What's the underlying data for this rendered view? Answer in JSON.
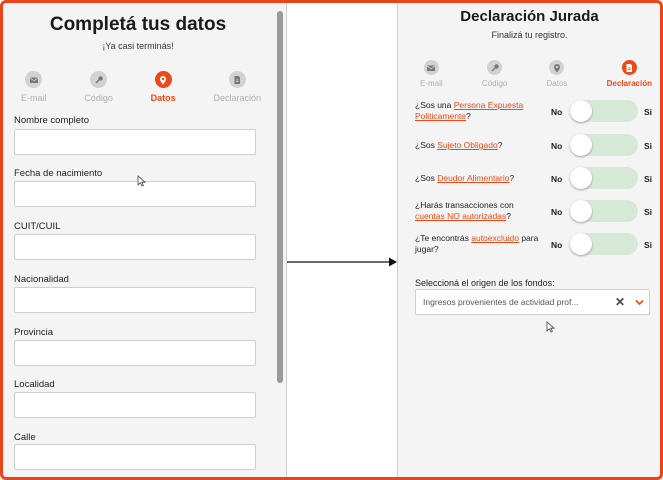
{
  "left_panel": {
    "title": "Completá tus datos",
    "subtitle": "¡Ya casi terminás!",
    "steps": [
      {
        "label": "E-mail",
        "icon": "envelope-icon",
        "active": false
      },
      {
        "label": "Código",
        "icon": "key-icon",
        "active": false
      },
      {
        "label": "Datos",
        "icon": "location-pin-icon",
        "active": true
      },
      {
        "label": "Declaración",
        "icon": "document-icon",
        "active": false
      }
    ],
    "fields": [
      {
        "label": "Nombre completo",
        "value": ""
      },
      {
        "label": "Fecha de nacimiento",
        "value": ""
      },
      {
        "label": "CUIT/CUIL",
        "value": ""
      },
      {
        "label": "Nacionalidad",
        "value": ""
      },
      {
        "label": "Provincia",
        "value": ""
      },
      {
        "label": "Localidad",
        "value": ""
      },
      {
        "label": "Calle",
        "value": ""
      }
    ]
  },
  "right_panel": {
    "title": "Declaración Jurada",
    "subtitle": "Finalizá tu registro.",
    "steps": [
      {
        "label": "E-mail",
        "icon": "envelope-icon",
        "active": false
      },
      {
        "label": "Código",
        "icon": "key-icon",
        "active": false
      },
      {
        "label": "Datos",
        "icon": "location-pin-icon",
        "active": false
      },
      {
        "label": "Declaración",
        "icon": "document-icon",
        "active": true
      }
    ],
    "questions": [
      {
        "pre": "¿Sos una ",
        "link": "Persona Expuesta Politicamente",
        "post": "?"
      },
      {
        "pre": "¿Sos ",
        "link": "Sujeto Obligado",
        "post": "?"
      },
      {
        "pre": "¿Sos ",
        "link": "Deudor Alimentario",
        "post": "?"
      },
      {
        "pre": "¿Harás transacciones con ",
        "link": "cuentas NO autorizadas",
        "post": "?"
      },
      {
        "pre": "¿Te encontrás ",
        "link": "autoexcluido",
        "post": " para jugar?"
      }
    ],
    "toggle_no_label": "No",
    "toggle_yes_label": "Si",
    "funds_label": "Seleccioná el origen de los fondos:",
    "funds_value": "Ingresos provenientes de actividad prof...",
    "clear_symbol": "✕"
  },
  "colors": {
    "accent": "#ea4a18",
    "frame": "#e8451e",
    "toggle_track": "#d6e9d6",
    "panel_bg": "#f4f4f4"
  }
}
